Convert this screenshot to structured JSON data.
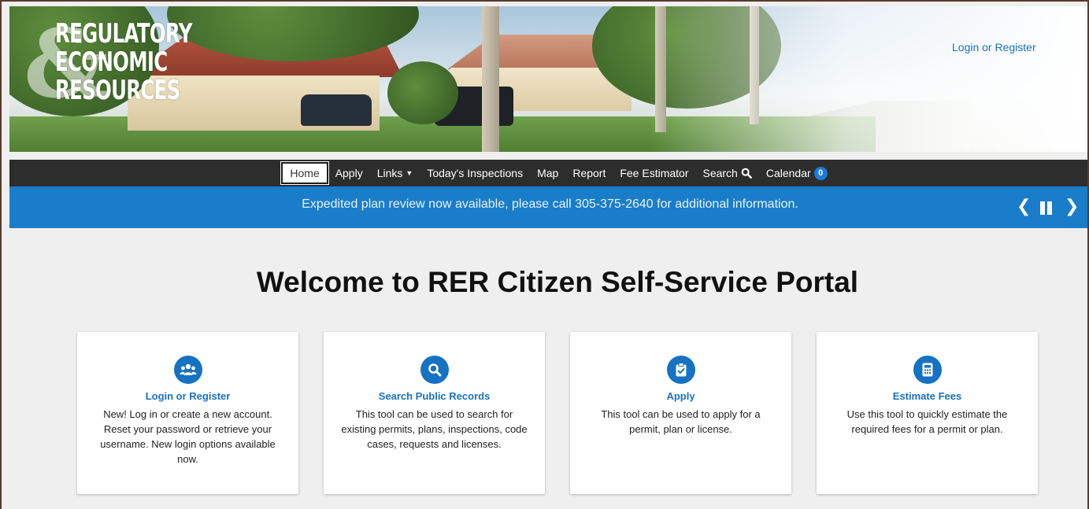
{
  "header": {
    "logo": {
      "line1": "REGULATORY",
      "line2": "ECONOMIC",
      "line3": "RESOURCES",
      "ampersand": "&"
    },
    "login_link": "Login or Register"
  },
  "nav": {
    "items": [
      {
        "label": "Home",
        "active": true
      },
      {
        "label": "Apply"
      },
      {
        "label": "Links",
        "icon": "caret-down-icon"
      },
      {
        "label": "Today's Inspections"
      },
      {
        "label": "Map"
      },
      {
        "label": "Report"
      },
      {
        "label": "Fee Estimator"
      },
      {
        "label": "Search",
        "icon": "search-icon"
      },
      {
        "label": "Calendar",
        "badge": "0"
      }
    ]
  },
  "announcement": {
    "message": "Expedited plan review now available, please call 305-375-2640 for additional information."
  },
  "main": {
    "title": "Welcome to RER Citizen Self-Service Portal",
    "cards": [
      {
        "icon": "users-icon",
        "title": "Login or Register",
        "description": "New! Log in or create a new account. Reset your password or retrieve your username. New login options available now."
      },
      {
        "icon": "search-icon",
        "title": "Search Public Records",
        "description": "This tool can be used to search for existing permits, plans, inspections, code cases, requests and licenses."
      },
      {
        "icon": "clipboard-check-icon",
        "title": "Apply",
        "description": "This tool can be used to apply for a permit, plan or license."
      },
      {
        "icon": "calculator-icon",
        "title": "Estimate Fees",
        "description": "Use this tool to quickly estimate the required fees for a permit or plan."
      }
    ]
  },
  "colors": {
    "accent_blue": "#1672c2",
    "announcement_bg": "#1a7dc9",
    "nav_bg": "#2d2d2d",
    "page_bg": "#efefef"
  }
}
